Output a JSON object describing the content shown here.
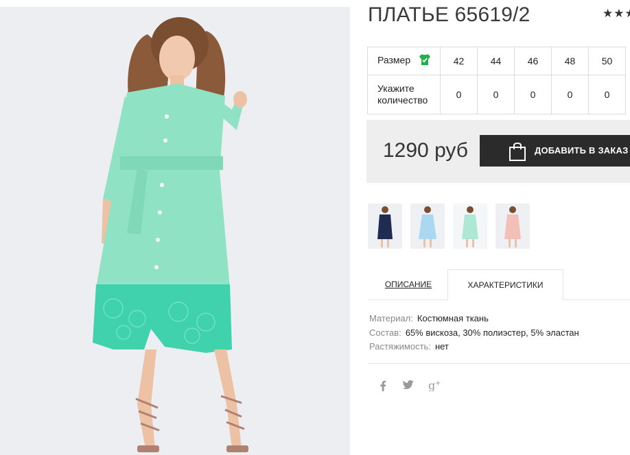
{
  "product": {
    "title": "ПЛАТЬЕ 65619/2",
    "rating_stars": "★★★"
  },
  "sizes": {
    "size_label": "Размер",
    "qty_label_line1": "Укажите",
    "qty_label_line2": "количество",
    "values": [
      "42",
      "44",
      "46",
      "48",
      "50"
    ],
    "quantities": [
      "0",
      "0",
      "0",
      "0",
      "0"
    ]
  },
  "purchase": {
    "price": "1290 руб",
    "add_button": "ДОБАВИТЬ В ЗАКАЗ"
  },
  "thumbnails": [
    {
      "color": "#1f2c52",
      "name": "navy"
    },
    {
      "color": "#a9d8f0",
      "name": "light-blue"
    },
    {
      "color": "#aee8d4",
      "name": "mint"
    },
    {
      "color": "#f2c0b6",
      "name": "peach"
    }
  ],
  "tabs": {
    "description": "ОПИСАНИЕ",
    "characteristics": "ХАРАКТЕРИСТИКИ"
  },
  "characteristics": [
    {
      "key": "Материал:",
      "value": "Костюмная ткань"
    },
    {
      "key": "Состав:",
      "value": "65% вискоза, 30% полиэстер, 5% эластан"
    },
    {
      "key": "Растяжимость:",
      "value": "нет"
    }
  ],
  "social": {
    "facebook": "f",
    "twitter": "🐦",
    "googleplus": "g+"
  },
  "colors": {
    "dress": "#8fe3c4",
    "lace": "#3fd2ad",
    "button_bg": "#2b2b2b",
    "size_icon": "#23b04a"
  }
}
